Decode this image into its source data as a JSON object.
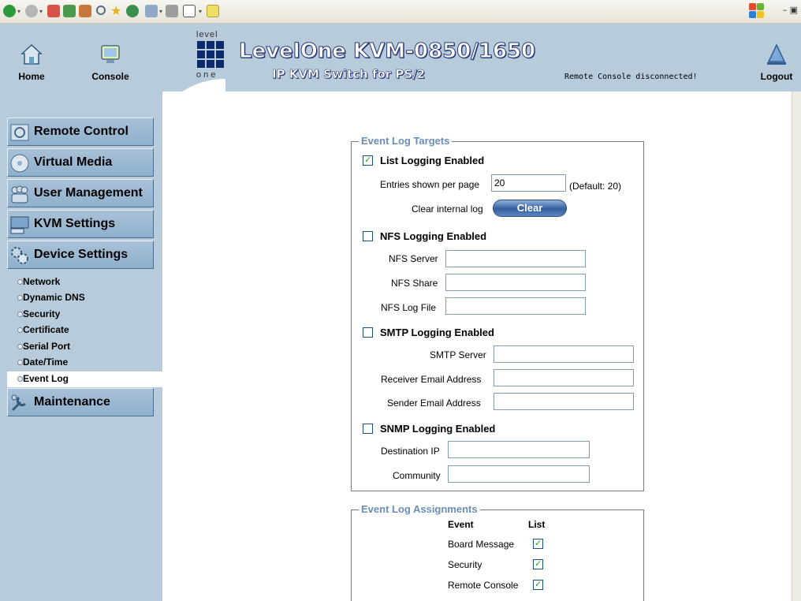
{
  "header": {
    "home_label": "Home",
    "console_label": "Console",
    "logout_label": "Logout",
    "logo_top": "level",
    "logo_bottom": "one",
    "product_title": "LevelOne KVM-0850/1650",
    "product_subtitle": "IP KVM Switch for PS/2",
    "status": "Remote Console disconnected!"
  },
  "sidebar": {
    "menu": [
      {
        "label": "Remote Control",
        "icon": "remote-control-icon"
      },
      {
        "label": "Virtual Media",
        "icon": "virtual-media-icon"
      },
      {
        "label": "User Management",
        "icon": "user-management-icon"
      },
      {
        "label": "KVM Settings",
        "icon": "kvm-settings-icon"
      },
      {
        "label": "Device Settings",
        "icon": "device-settings-icon"
      }
    ],
    "sub_items": [
      {
        "label": "Network",
        "active": false
      },
      {
        "label": "Dynamic DNS",
        "active": false
      },
      {
        "label": "Security",
        "active": false
      },
      {
        "label": "Certificate",
        "active": false
      },
      {
        "label": "Serial Port",
        "active": false
      },
      {
        "label": "Date/Time",
        "active": false
      },
      {
        "label": "Event Log",
        "active": true
      }
    ],
    "maintenance_label": "Maintenance"
  },
  "targets": {
    "legend": "Event Log Targets",
    "list_logging": {
      "label": "List Logging Enabled",
      "checked": true
    },
    "entries_label": "Entries shown per page",
    "entries_value": "20",
    "entries_default": "(Default: 20)",
    "clear_label": "Clear internal log",
    "clear_button": "Clear",
    "nfs_logging": {
      "label": "NFS Logging Enabled",
      "checked": false
    },
    "nfs_server_label": "NFS Server",
    "nfs_share_label": "NFS Share",
    "nfs_logfile_label": "NFS Log File",
    "smtp_logging": {
      "label": "SMTP Logging Enabled",
      "checked": false
    },
    "smtp_server_label": "SMTP Server",
    "receiver_label": "Receiver Email Address",
    "sender_label": "Sender Email Address",
    "snmp_logging": {
      "label": "SNMP Logging Enabled",
      "checked": false
    },
    "dest_ip_label": "Destination IP",
    "community_label": "Community"
  },
  "assignments": {
    "legend": "Event Log Assignments",
    "col_event": "Event",
    "col_list": "List",
    "rows": [
      {
        "event": "Board Message",
        "list": true
      },
      {
        "event": "Security",
        "list": true
      },
      {
        "event": "Remote Console",
        "list": true
      }
    ]
  },
  "colors": {
    "accent": "#6a8db8",
    "sidebar_bg": "#b7cbdb",
    "menu_button": "#a0bad2"
  }
}
